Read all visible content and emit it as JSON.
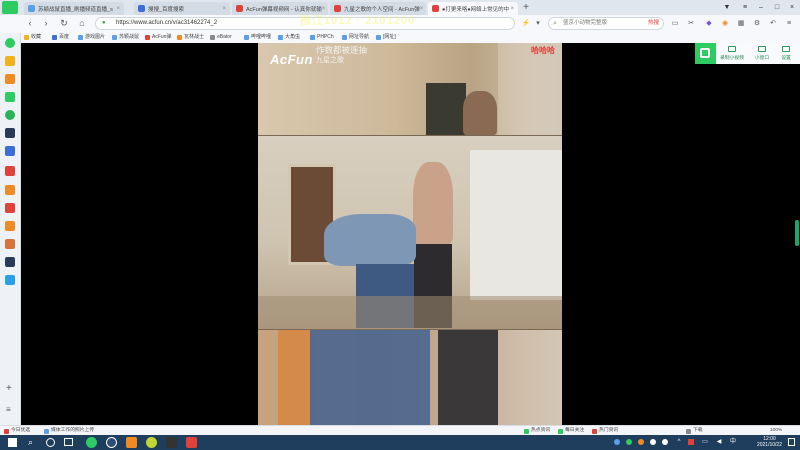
{
  "browser": {
    "tabs": [
      {
        "label": "苏颖战鼠直播_刷播频道直播_s",
        "color": "#5aa0e8",
        "active": false
      },
      {
        "label": "搜搜_百度搜索",
        "color": "#3b6fd6",
        "active": false
      },
      {
        "label": "AcFun弹幕视频网 - 认真你就输",
        "color": "#e0413a",
        "active": false
      },
      {
        "label": "九星之歌的个人空间 - AcFun弹",
        "color": "#e0413a",
        "active": false
      },
      {
        "label": "●打更来咯●网络上常见的中",
        "color": "#e0413a",
        "active": true
      }
    ],
    "new_tab": "+",
    "address": "https://www.acfun.cn/v/ac31462274_2",
    "search_placeholder": "盛京小动物完整版",
    "search_hot": "热搜",
    "bookmarks": [
      {
        "label": "收藏",
        "color": "#f2b21b"
      },
      {
        "label": "百度",
        "color": "#3b6fd6"
      },
      {
        "label": "游戏图片",
        "color": "#5aa0e8"
      },
      {
        "label": "苏颖战鼠",
        "color": "#5aa0e8"
      },
      {
        "label": "AcFun弹",
        "color": "#e0413a"
      },
      {
        "label": "瓦林战士",
        "color": "#f08a24"
      },
      {
        "label": "eBator",
        "color": "#888888"
      },
      {
        "label": "哔哩哔哩",
        "color": "#5aa0e8"
      },
      {
        "label": "大角虫",
        "color": "#5aa0e8"
      },
      {
        "label": "PHPCh",
        "color": "#5aa0e8"
      },
      {
        "label": "网址导航",
        "color": "#5aa0e8"
      },
      {
        "label": "[网址]",
        "color": "#5aa0e8"
      }
    ]
  },
  "video": {
    "logo": "AcFun",
    "watermark_line1": "作数都被连抽",
    "watermark_line2": "九星之歌",
    "corner_tag": "哈哈哈",
    "danmaku": "推江1012  · 2101200"
  },
  "side_panel": {
    "items": [
      {
        "label": "录制小视频"
      },
      {
        "label": "小窗口"
      },
      {
        "label": "设置"
      }
    ]
  },
  "statusbar": {
    "left": [
      {
        "label": "今日优选",
        "color": "#e0413a"
      },
      {
        "label": "媒体工作的照片上传",
        "color": "#5aa0e8"
      }
    ],
    "right": [
      {
        "label": "热点资讯"
      },
      {
        "label": "每日关注"
      },
      {
        "label": "热门资讯"
      },
      {
        "label": "下载"
      },
      {
        "label": "100%"
      }
    ]
  },
  "taskbar": {
    "time": "12:00",
    "date": "2021/10/22"
  },
  "colors": {
    "accent_green": "#2ecb63",
    "acfun_red": "#e0413a",
    "taskbar": "#1f3d5c"
  }
}
